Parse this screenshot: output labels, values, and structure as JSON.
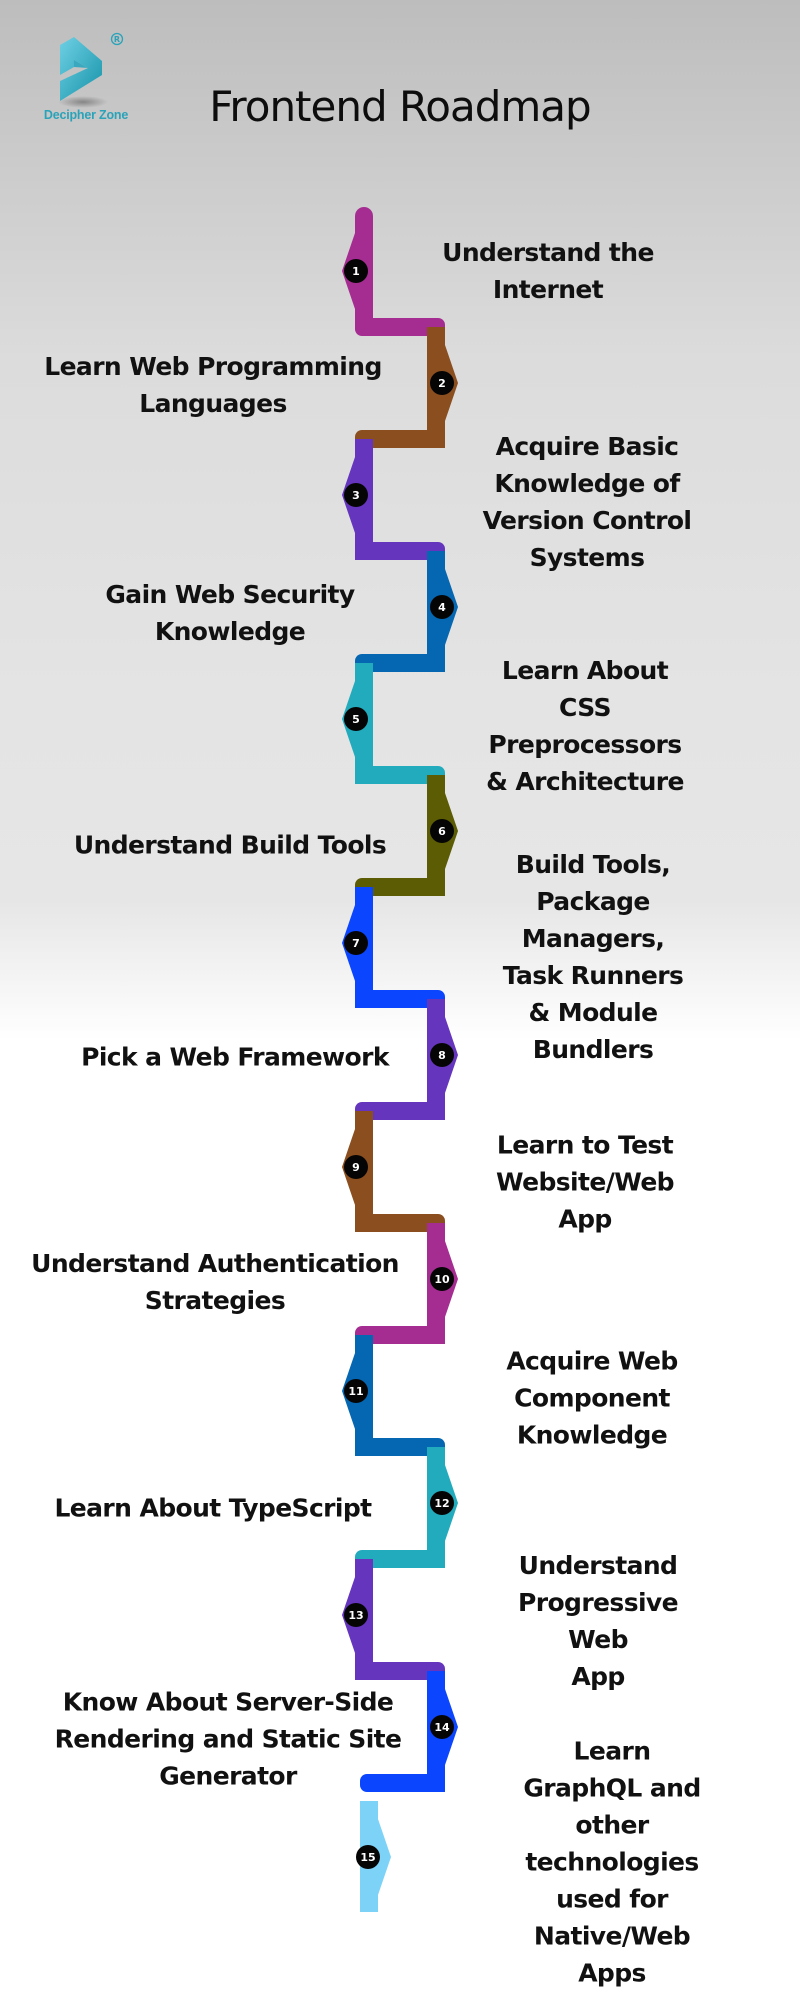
{
  "brand": {
    "name": "Decipher Zone",
    "registered_mark": "®",
    "color": "#2aa3b9"
  },
  "title": "Frontend Roadmap",
  "steps": [
    {
      "number": "1",
      "label": "Understand the Internet",
      "color": "#a52d91",
      "side": "right"
    },
    {
      "number": "2",
      "label": "Learn Web Programming\nLanguages",
      "color": "#8a4e1f",
      "side": "left"
    },
    {
      "number": "3",
      "label": "Acquire Basic Knowledge of\nVersion Control Systems",
      "color": "#6535bd",
      "side": "right"
    },
    {
      "number": "4",
      "label": "Gain Web Security\nKnowledge",
      "color": "#0567b1",
      "side": "left"
    },
    {
      "number": "5",
      "label": "Learn About CSS\nPreprocessors & Architecture",
      "color": "#22abbd",
      "side": "right"
    },
    {
      "number": "6",
      "label": "Understand Build Tools",
      "color": "#5c5c05",
      "side": "left"
    },
    {
      "number": "7",
      "label": "Build Tools, Package Managers,\nTask Runners & Module\nBundlers",
      "color": "#0b46fe",
      "side": "right"
    },
    {
      "number": "8",
      "label": "Pick a Web Framework",
      "color": "#6535bd",
      "side": "left"
    },
    {
      "number": "9",
      "label": "Learn to Test Website/Web\nApp",
      "color": "#8a4e1f",
      "side": "right"
    },
    {
      "number": "10",
      "label": "Understand Authentication\nStrategies",
      "color": "#a52d91",
      "side": "left"
    },
    {
      "number": "11",
      "label": "Acquire Web Component\nKnowledge",
      "color": "#0567b1",
      "side": "right"
    },
    {
      "number": "12",
      "label": "Learn About TypeScript",
      "color": "#22abbd",
      "side": "left"
    },
    {
      "number": "13",
      "label": "Understand Progressive Web\nApp",
      "color": "#6535bd",
      "side": "right"
    },
    {
      "number": "14",
      "label": "Know About Server-Side\nRendering and Static Site\nGenerator",
      "color": "#0b46fe",
      "side": "left"
    },
    {
      "number": "15",
      "label": "Learn GraphQL and other\ntechnologies used for\nNative/Web Apps",
      "color": "#7dd3f7",
      "side": "right"
    }
  ]
}
